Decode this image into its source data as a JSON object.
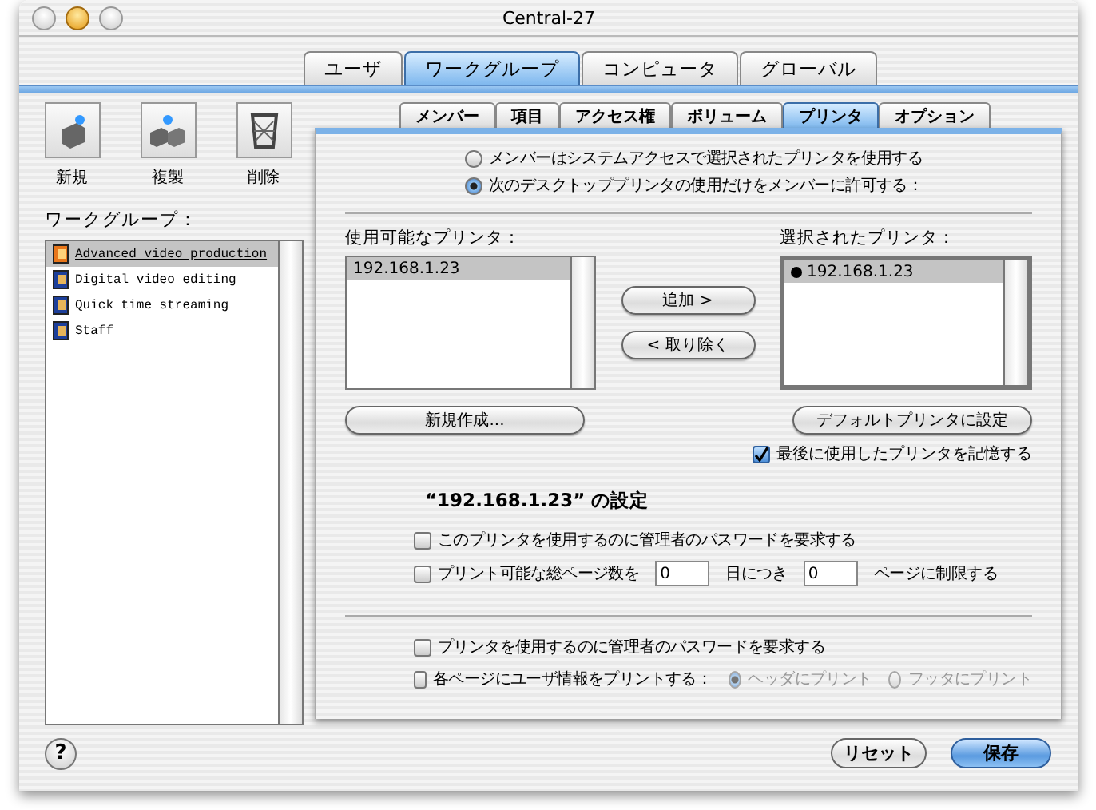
{
  "window": {
    "title": "Central-27"
  },
  "main_tabs": [
    {
      "label": "ユーザ",
      "selected": false
    },
    {
      "label": "ワークグループ",
      "selected": true
    },
    {
      "label": "コンピュータ",
      "selected": false
    },
    {
      "label": "グローバル",
      "selected": false
    }
  ],
  "toolbar": [
    {
      "label": "新規",
      "kind": "new"
    },
    {
      "label": "複製",
      "kind": "duplicate"
    },
    {
      "label": "削除",
      "kind": "delete"
    }
  ],
  "workgroups": {
    "label": "ワークグループ：",
    "items": [
      {
        "name": "Advanced video production",
        "selected": true
      },
      {
        "name": "Digital video editing",
        "selected": false
      },
      {
        "name": "Quick time streaming",
        "selected": false
      },
      {
        "name": "Staff",
        "selected": false
      }
    ]
  },
  "sub_tabs": [
    {
      "label": "メンバー",
      "selected": false
    },
    {
      "label": "項目",
      "selected": false
    },
    {
      "label": "アクセス権",
      "selected": false
    },
    {
      "label": "ボリューム",
      "selected": false
    },
    {
      "label": "プリンタ",
      "selected": true
    },
    {
      "label": "オプション",
      "selected": false
    }
  ],
  "access_options": [
    {
      "label": "メンバーはシステムアクセスで選択されたプリンタを使用する",
      "selected": false
    },
    {
      "label": "次のデスクトッププリンタの使用だけをメンバーに許可する：",
      "selected": true
    }
  ],
  "available": {
    "label": "使用可能なプリンタ：",
    "items": [
      {
        "name": "192.168.1.23",
        "selected": true
      }
    ]
  },
  "add_button": "追加 >",
  "remove_button": "< 取り除く",
  "chosen": {
    "label": "選択されたプリンタ：",
    "items": [
      {
        "name": "192.168.1.23",
        "selected": true,
        "default": true
      }
    ]
  },
  "new_button": "新規作成...",
  "default_button": "デフォルトプリンタに設定",
  "remember": {
    "label": "最後に使用したプリンタを記憶する",
    "checked": true
  },
  "settings": {
    "title": "“192.168.1.23” の設定",
    "require_password": {
      "label": "このプリンタを使用するのに管理者のパスワードを要求する",
      "checked": false
    },
    "limit": {
      "label": "プリント可能な総ページ数を",
      "checked": false,
      "pages": "0",
      "per": "日につき",
      "days": "0",
      "suffix": "ページに制限する"
    }
  },
  "global": {
    "require_password": {
      "label": "プリンタを使用するのに管理者のパスワードを要求する",
      "checked": false
    },
    "user_info": {
      "label": "各ページにユーザ情報をプリントする：",
      "checked": false,
      "options": [
        {
          "label": "ヘッダにプリント",
          "selected": true,
          "disabled": true
        },
        {
          "label": "フッタにプリント",
          "selected": false,
          "disabled": true
        }
      ]
    }
  },
  "help": "?",
  "reset_button": "リセット",
  "save_button": "保存"
}
